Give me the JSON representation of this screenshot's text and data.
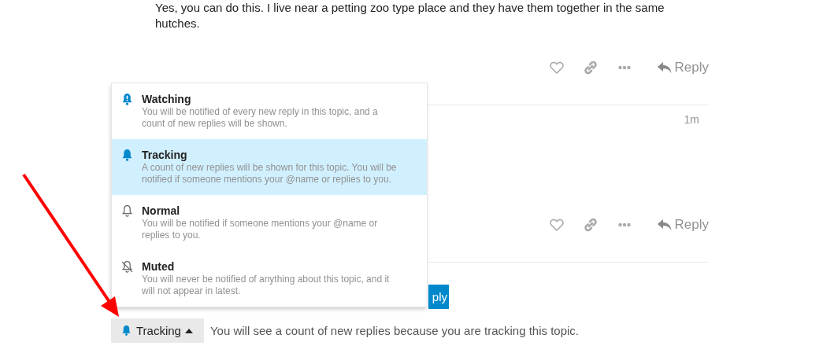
{
  "posts": [
    {
      "body": "Yes, you can do this. I live near a petting zoo type place and they have them together in the same hutches.",
      "reply_label": "Reply"
    },
    {
      "time": "1m",
      "reply_label": "Reply"
    }
  ],
  "covered_button": {
    "label": "ply"
  },
  "notification_menu": {
    "items": [
      {
        "kind": "watching",
        "title": "Watching",
        "description": "You will be notified of every new reply in this topic, and a count of new replies will be shown.",
        "selected": false
      },
      {
        "kind": "tracking",
        "title": "Tracking",
        "description": "A count of new replies will be shown for this topic. You will be notified if someone mentions your @name or replies to you.",
        "selected": true
      },
      {
        "kind": "normal",
        "title": "Normal",
        "description": "You will be notified if someone mentions your @name or replies to you.",
        "selected": false
      },
      {
        "kind": "muted",
        "title": "Muted",
        "description": "You will never be notified of anything about this topic, and it will not appear in latest.",
        "selected": false
      }
    ]
  },
  "footer": {
    "button": {
      "kind": "tracking",
      "label": "Tracking",
      "expanded": true
    },
    "message": "You will see a count of new replies because you are tracking this topic."
  }
}
